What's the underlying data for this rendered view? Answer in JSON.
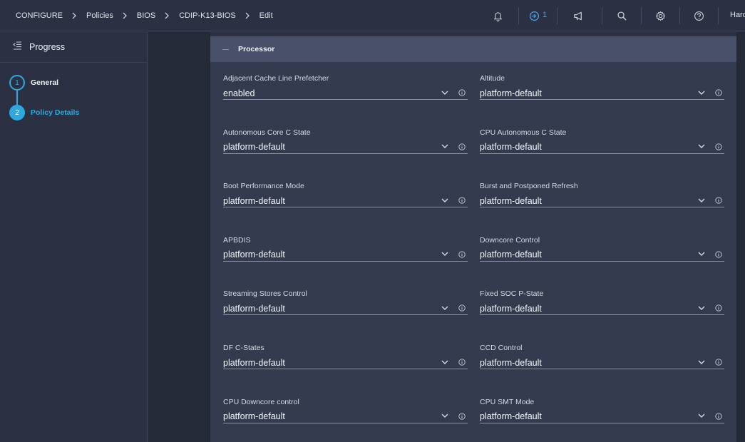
{
  "breadcrumb": [
    "CONFIGURE",
    "Policies",
    "BIOS",
    "CDIP-K13-BIOS",
    "Edit"
  ],
  "topbar": {
    "icons": [
      "bell-icon",
      "login-icon",
      "megaphone-icon",
      "search-icon",
      "gear-icon",
      "help-icon"
    ],
    "login_count": "1",
    "user_name": "Hard"
  },
  "progress": {
    "title": "Progress",
    "steps": [
      {
        "number": "1",
        "label": "General",
        "active": false
      },
      {
        "number": "2",
        "label": "Policy Details",
        "active": true
      }
    ]
  },
  "section": {
    "title": "Processor"
  },
  "fields": [
    {
      "label": "Adjacent Cache Line Prefetcher",
      "value": "enabled"
    },
    {
      "label": "Altitude",
      "value": "platform-default"
    },
    {
      "label": "Autonomous Core C State",
      "value": "platform-default"
    },
    {
      "label": "CPU Autonomous C State",
      "value": "platform-default"
    },
    {
      "label": "Boot Performance Mode",
      "value": "platform-default"
    },
    {
      "label": "Burst and Postponed Refresh",
      "value": "platform-default"
    },
    {
      "label": "APBDIS",
      "value": "platform-default"
    },
    {
      "label": "Downcore Control",
      "value": "platform-default"
    },
    {
      "label": "Streaming Stores Control",
      "value": "platform-default"
    },
    {
      "label": "Fixed SOC P-State",
      "value": "platform-default"
    },
    {
      "label": "DF C-States",
      "value": "platform-default"
    },
    {
      "label": "CCD Control",
      "value": "platform-default"
    },
    {
      "label": "CPU Downcore control",
      "value": "platform-default"
    },
    {
      "label": "CPU SMT Mode",
      "value": "platform-default"
    }
  ],
  "colors": {
    "accent": "#2ea8e0",
    "background": "#2b3142",
    "panel": "#343b4f",
    "section_header": "#48506a"
  }
}
